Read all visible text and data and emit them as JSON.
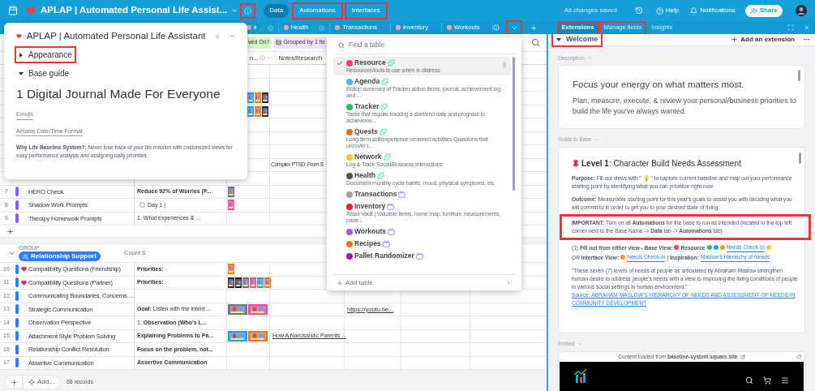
{
  "topbar": {
    "title": "APLAP | Automated Personal Life Assist...",
    "info_highlighted": true,
    "nav": [
      {
        "label": "Data",
        "selected": true,
        "highlighted": false
      },
      {
        "label": "Automations",
        "selected": false,
        "highlighted": true
      },
      {
        "label": "Interfaces",
        "selected": false,
        "highlighted": true
      }
    ],
    "status": "All changes saved",
    "help": "Help",
    "notifications": "Notifications",
    "share": "Share"
  },
  "table_tabs": {
    "menu_highlighted": true,
    "tabs": [
      {
        "label": "k",
        "synced": true
      },
      {
        "label": "Health",
        "synced": true
      },
      {
        "label": "Transactions",
        "synced": false
      },
      {
        "label": "Inventory",
        "synced": false
      },
      {
        "label": "Workouts",
        "synced": false
      }
    ]
  },
  "panel_tabs": [
    {
      "label": "Extensions",
      "selected": true,
      "highlighted": true
    },
    {
      "label": "Manage fields",
      "selected": false,
      "highlighted": true
    },
    {
      "label": "Insights",
      "selected": false,
      "highlighted": false
    }
  ],
  "toolbar": {
    "chips": [
      {
        "label": "ved On?",
        "kind": "filter"
      },
      {
        "label": "Grouped by 1 fie",
        "kind": "group"
      }
    ]
  },
  "columns": [
    {
      "label": "n..."
    },
    {
      "label": "Notes/Research"
    }
  ],
  "covered_rows": [
    {
      "attachments": [
        {
          "kind": "picture"
        },
        {
          "kind": "picture"
        },
        {
          "kind": "picture"
        }
      ]
    },
    {
      "attachments": [
        {
          "kind": "picture"
        },
        {
          "kind": "picture"
        },
        {
          "kind": "picture"
        }
      ]
    },
    {
      "notes": "Complex PTSD: From S"
    }
  ],
  "groups": [
    {
      "color": "#8b5cf6",
      "rows": [
        {
          "number": "7",
          "name": "HERO Check",
          "summary": "**Reduce 92% of Worries (P...**",
          "attachments": [
            {
              "kind": "picture"
            }
          ]
        },
        {
          "number": "8",
          "name": "Shadow Work Prompts",
          "checkbox": true,
          "summary": "Day 1 |",
          "attachments": [
            {
              "kind": "picture"
            }
          ]
        },
        {
          "number": "9",
          "name": "Therapy Homework Prompts",
          "summary": "1. What experiences & ..."
        }
      ]
    },
    {
      "color": "#2d7ff9",
      "label": "GROUP",
      "title": "Relationship Support",
      "count": "Count 8",
      "rows": [
        {
          "number": "10",
          "name": "Compatibility Questions (Friendship)",
          "emoji": true,
          "summary": "**Priorities:**",
          "attachments": [
            {
              "kind": "picture"
            }
          ]
        },
        {
          "number": "11",
          "name": "Compatibility Questions (Partner)",
          "emoji": true,
          "summary": "**Priorities:**",
          "attachments": [
            {
              "kind": "picture"
            },
            {
              "kind": "picture"
            },
            {
              "kind": "picture"
            },
            {
              "kind": "picture"
            },
            {
              "kind": "picture"
            },
            {
              "kind": "picture"
            }
          ]
        },
        {
          "number": "12",
          "name": "Communicating Boundaries, Concerns ..."
        },
        {
          "number": "13",
          "name": "Strategic Communication",
          "summary": "**Goal:** Listen with the intent ...",
          "attachments": [
            {
              "kind": "picture"
            },
            {
              "kind": "picture"
            }
          ],
          "link": "https://youtu.be..."
        },
        {
          "number": "14",
          "name": "Observation Perspective",
          "summary": "1. **Observation (Who's L...**"
        },
        {
          "number": "15",
          "name": "Attachment Style Problem Solving",
          "summary": "**Explaining Problems to Pa...**",
          "attachments": [
            {
              "kind": "picture"
            },
            {
              "kind": "picture"
            }
          ],
          "notes_link": "How A Narcissistic Parents ..."
        },
        {
          "number": "16",
          "name": "Relationship Conflict Resolution",
          "summary": "**Focus on the problem, not...**"
        },
        {
          "number": "17",
          "name": "Assertive Communication",
          "summary": "**Assertive Communication**"
        }
      ]
    }
  ],
  "footer": {
    "add_label": "Add...",
    "records": "68 records"
  },
  "base_popup": {
    "title": "APLAP | Automated Personal Life Assistant",
    "sections": [
      {
        "label": "Appearance",
        "expanded": false,
        "highlighted": true
      },
      {
        "label": "Base guide",
        "expanded": true,
        "highlighted": false
      }
    ],
    "heading": "1 Digital Journal Made For Everyone",
    "links": [
      "Emojis",
      "Airtable Date/Time Format"
    ],
    "paragraph": "**Why Life Baseline System?:** Never lose track of your life mission with customized  views for easy performance analysis and assigning daily priorities"
  },
  "table_menu": {
    "placeholder": "Find a table",
    "add": "Add table",
    "items": [
      {
        "name": "Resource",
        "color": "#f43f5e",
        "synced": true,
        "selected": true,
        "description": "Resources/tools to use when in distress"
      },
      {
        "name": "Agenda",
        "color": "#60a5fa",
        "synced": true,
        "selected": false,
        "description": "Rollup summary of Tracker action items, journal, achievement log, and ..."
      },
      {
        "name": "Tracker",
        "color": "#22c55e",
        "synced": true,
        "selected": false,
        "description": "Tasks that require tracking a start/end date and progress to achieveme..."
      },
      {
        "name": "Quests",
        "color": "#d97706",
        "synced": true,
        "selected": false,
        "description": "Long-term skill/experience centered activities Questions that uncover t..."
      },
      {
        "name": "Network",
        "color": "#facc15",
        "synced": true,
        "selected": false,
        "description": "Log & Track Social/Business Interactions"
      },
      {
        "name": "Health",
        "color": "#6b4f3a",
        "synced": true,
        "selected": false,
        "description": "Document monthly cycle habits, mood, physical symptoms, etc"
      },
      {
        "name": "Transactions",
        "color": "#9ca3af",
        "synced": false,
        "selected": false
      },
      {
        "name": "Inventory",
        "color": "#dc2626",
        "synced": false,
        "selected": false,
        "description": "Asset Vault | Valuable items, home map, furniture measurements, pantr..."
      },
      {
        "name": "Workouts",
        "color": "#a855f7",
        "synced": false,
        "selected": false
      },
      {
        "name": "Recipes",
        "color": "#f97316",
        "synced": false,
        "selected": false
      },
      {
        "name": "Pallet Randomizer",
        "color": "#a21caf",
        "synced": false,
        "selected": false
      }
    ]
  },
  "extensions": {
    "section": {
      "label": "Welcome",
      "highlighted": true
    },
    "add": "Add an extension",
    "description_label": "Description",
    "description_title": "Focus your energy on what matters most.",
    "description_body": "Plan, measure, execute, & review your personal/business priorities to build the life you've always wanted.",
    "guide_label": "Guide to Base",
    "guide_heading": "**Level 1**: Character Build Needs Assessment",
    "guide_paragraphs": [
      {
        "text": "**Purpose:** Fill out views with \" 💡 \" to capture current baseline and map out your performance starting point by identifying what you can prioritize right now",
        "highlighted": false
      },
      {
        "text": "**Outcome:** Measurable starting point for this year's goals to assist you with deciding what you will commit to in order to get you to your desired state of living",
        "highlighted": false
      },
      {
        "text": "**IMPORTANT:** Turn on all **Automations** for the base to run as intended (located in the top left corner next to the Base Name -> **Data** tab -> **Automations** tab)",
        "highlighted": true
      }
    ],
    "step": [
      {
        "kind": "text",
        "text": "(1) **Fill out from either view - Base View:**"
      },
      {
        "kind": "icon",
        "color": "#f43f5e"
      },
      {
        "kind": "text",
        "text": "**Resource**"
      },
      {
        "kind": "icon",
        "color": "#22c55e"
      },
      {
        "kind": "icon",
        "color": "#0ea5e9"
      },
      {
        "kind": "icon",
        "color": "#f59e0b"
      },
      {
        "kind": "link",
        "text": "Needs Check-In"
      },
      {
        "kind": "icon",
        "color": "#facc15"
      },
      {
        "kind": "text",
        "text": "*OR* **Interface View:**"
      },
      {
        "kind": "icon",
        "color": "#f59e0b"
      },
      {
        "kind": "link",
        "text": "Needs Check-In"
      },
      {
        "kind": "text",
        "text": "| **Inspiration:**"
      },
      {
        "kind": "link",
        "text": "Maslow's Hierarchy of Needs"
      }
    ],
    "quote": "\"These seven (7) levels of needs of people as articulated by Abraham Maslow strengthen human desire to address people's needs with a view to improving the living conditions of people in various social settings in human environment.\"",
    "source": "Source: ABRAHAM MASLOW'S HIERARCHY OF NEEDS AND ASSESSMENT OF NEEDS IN COMMUNITY DEVELOPMENT",
    "embed_label": "Embed",
    "embed_note": "Content loaded from **baseline-system.square.site**"
  }
}
